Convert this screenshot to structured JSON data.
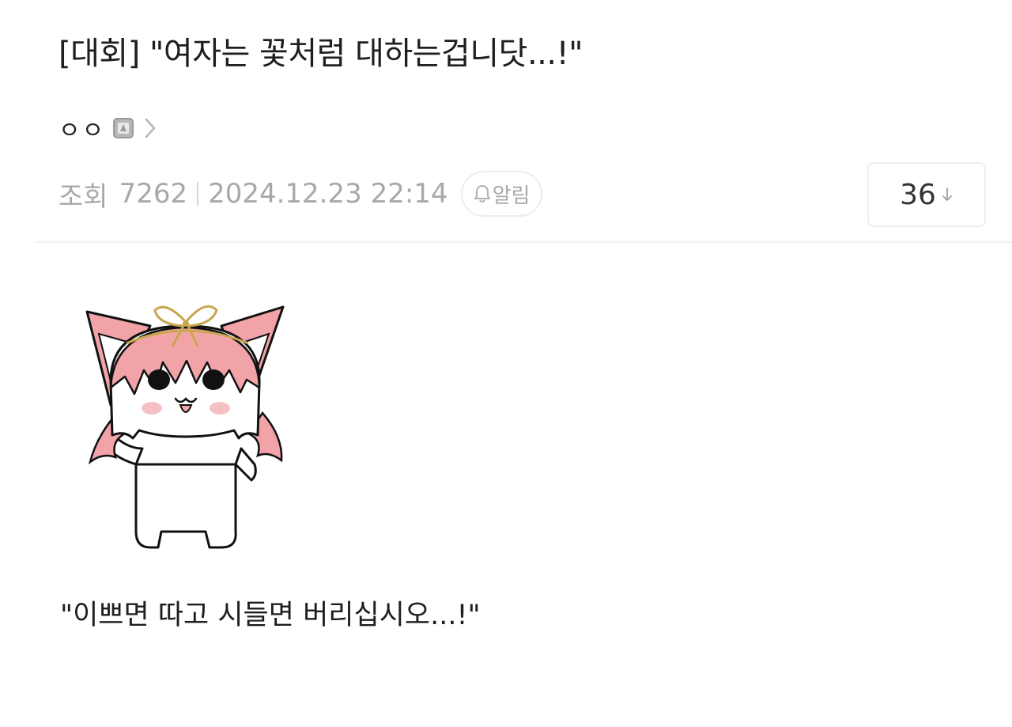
{
  "post": {
    "title": "[대회] \"여자는 꽃처럼 대하는겁니닷...!\"",
    "author": "ㅇㅇ",
    "views_label": "조회",
    "views_count": "7262",
    "datetime": "2024.12.23 22:14",
    "alarm_label": "알림",
    "comment_count": "36",
    "body_text": "\"이쁘면 따고 시들면 버리십시오...!\""
  },
  "icons": {
    "level": "level-badge-icon",
    "chevron": "chevron-right-icon",
    "bell": "bell-icon",
    "arrow": "arrow-down-icon"
  },
  "colors": {
    "title_text": "#1e1e1e",
    "meta_text": "#a8a8a8",
    "character_pink": "#f2a3a8",
    "ribbon_gold": "#c9a752"
  }
}
